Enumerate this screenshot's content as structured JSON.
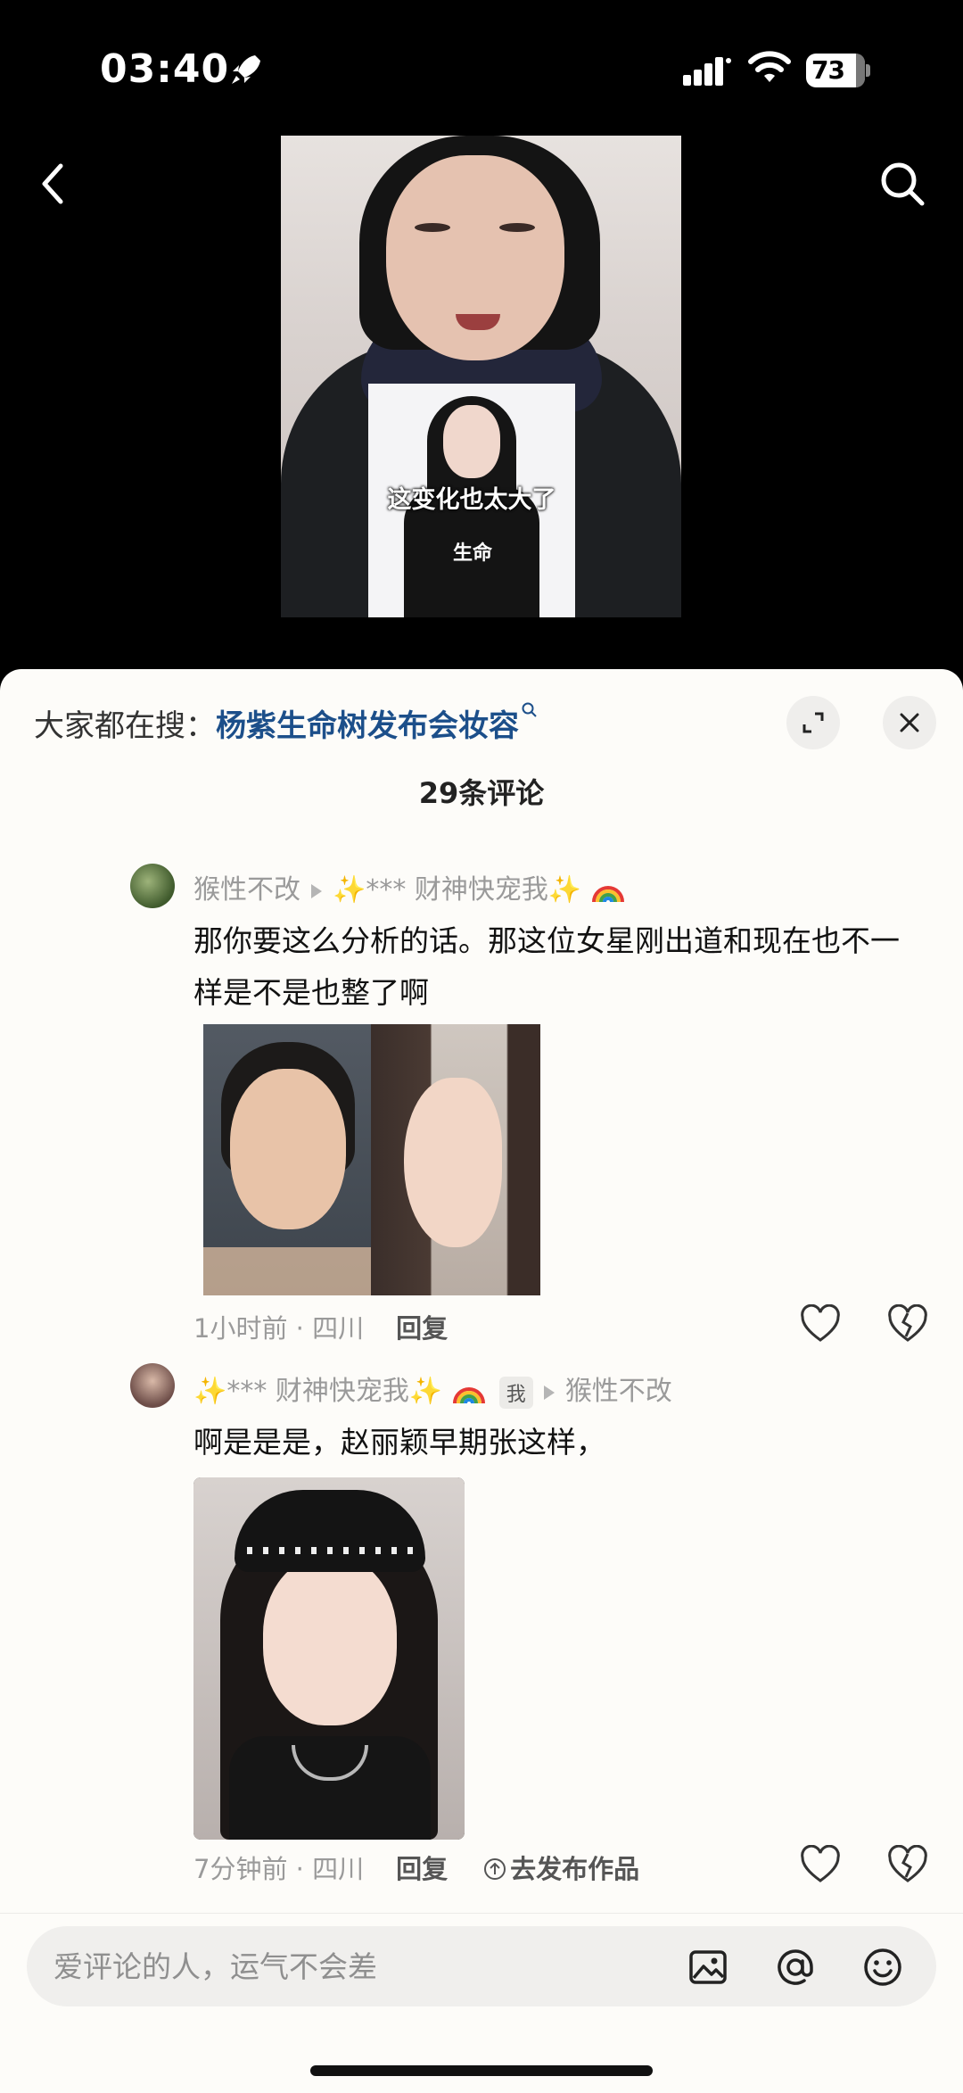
{
  "status_bar": {
    "time": "03:40",
    "battery_level": "73"
  },
  "video": {
    "overlay_caption": "这变化也太大了",
    "shirt_text": "生命"
  },
  "sheet": {
    "search_prefix": "大家都在搜：",
    "search_term": "杨紫生命树发布会妆容",
    "comment_count": "29条评论"
  },
  "comments": [
    {
      "user": "猴性不改",
      "reply_to": "✨*** 财神快宠我✨",
      "text": "那你要这么分析的话。那这位女星刚出道和现在也不一样是不是也整了啊",
      "time_location": "1小时前 · 四川",
      "reply_label": "回复"
    },
    {
      "user": "✨*** 财神快宠我✨",
      "badge": "我",
      "reply_to": "猴性不改",
      "text": "啊是是是，赵丽颖早期张这样，",
      "time_location": "7分钟前 · 四川",
      "reply_label": "回复",
      "publish_label": "去发布作品"
    }
  ],
  "composer": {
    "placeholder": "爱评论的人，运气不会差"
  },
  "icons": {
    "back": "chevron-left-icon",
    "search": "search-icon",
    "expand": "expand-icon",
    "close": "close-icon",
    "like": "heart-icon",
    "dislike": "broken-heart-icon",
    "image": "image-icon",
    "mention": "at-icon",
    "emoji": "emoji-icon"
  },
  "colors": {
    "link_blue": "#1c4f8a",
    "sheet_bg": "#fdfcf9"
  }
}
